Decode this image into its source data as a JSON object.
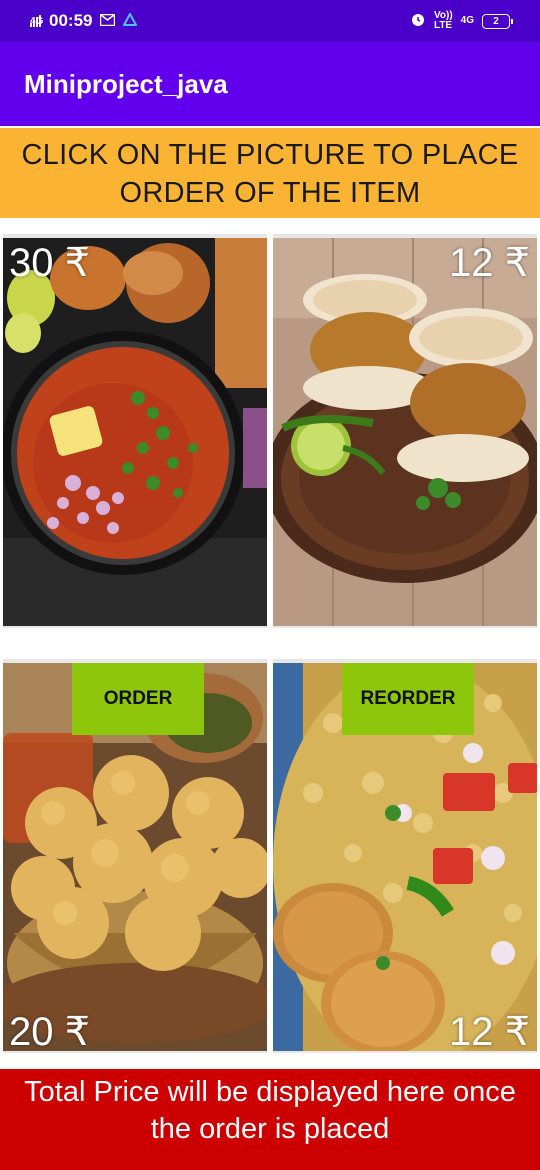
{
  "status_bar": {
    "network": "4G",
    "time": "00:59",
    "volte": "Vo))\nLTE",
    "network2": "4G",
    "battery": "2"
  },
  "app_bar": {
    "title": "Miniproject_java"
  },
  "banner": {
    "text": "CLICK ON THE PICTURE TO PLACE ORDER OF THE ITEM"
  },
  "items": [
    {
      "price": "30 ₹",
      "icon": "pav-bhaji-image"
    },
    {
      "price": "12 ₹",
      "icon": "vada-pav-image"
    },
    {
      "price": "20 ₹",
      "icon": "pani-puri-image",
      "button": "ORDER"
    },
    {
      "price": "12 ₹",
      "icon": "bhel-puri-image",
      "button": "REORDER"
    }
  ],
  "footer": {
    "text": "Total Price will be displayed here once the order is placed"
  },
  "colors": {
    "status_bar": "#4a00c8",
    "app_bar": "#6200ee",
    "banner": "#fbb334",
    "button": "#8dc60a",
    "footer": "#cc0000"
  }
}
